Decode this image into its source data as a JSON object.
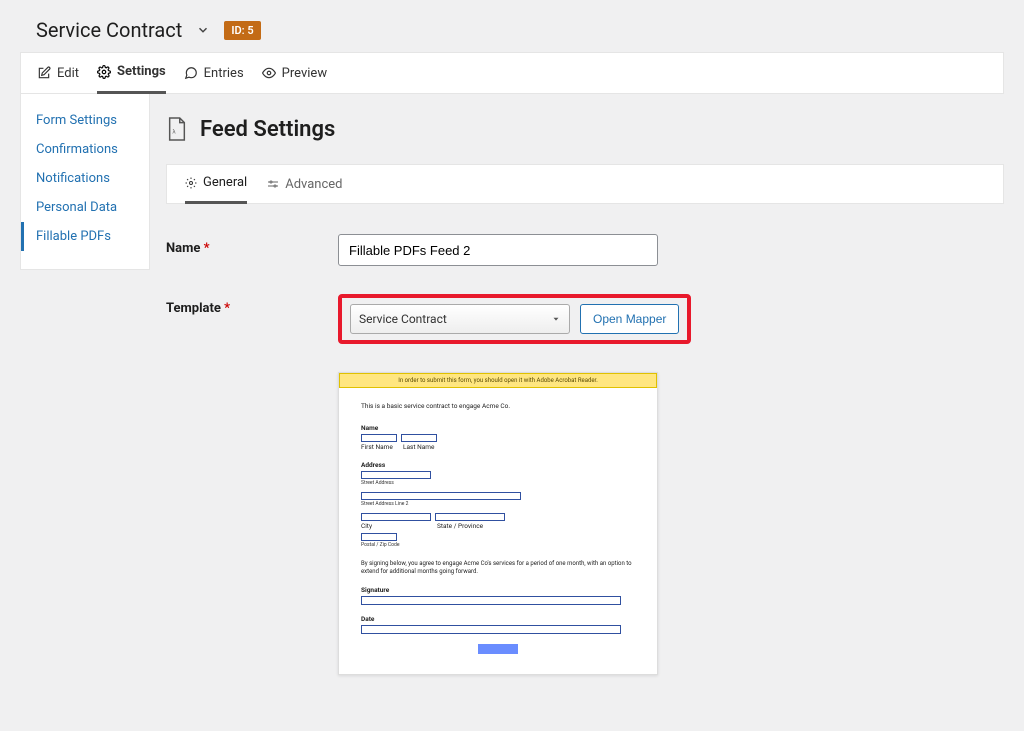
{
  "header": {
    "title": "Service Contract",
    "id_prefix": "ID:",
    "id_value": "5"
  },
  "tabs": {
    "edit": "Edit",
    "settings": "Settings",
    "entries": "Entries",
    "preview": "Preview"
  },
  "sidebar": {
    "items": [
      "Form Settings",
      "Confirmations",
      "Notifications",
      "Personal Data",
      "Fillable PDFs"
    ]
  },
  "main": {
    "title": "Feed Settings",
    "subtabs": {
      "general": "General",
      "advanced": "Advanced"
    },
    "name": {
      "label": "Name",
      "value": "Fillable PDFs Feed 2"
    },
    "template": {
      "label": "Template",
      "selected": "Service Contract",
      "open_mapper": "Open Mapper"
    }
  },
  "pdf": {
    "banner": "In order to submit this form, you should open it with Adobe Acrobat Reader.",
    "intro": "This is a basic service contract to engage Acme Co.",
    "name_label": "Name",
    "first_name": "First Name",
    "last_name": "Last Name",
    "address_label": "Address",
    "street": "Street Address",
    "street2": "Street Address Line 2",
    "city": "City",
    "state": "State / Province",
    "postal": "Postal / Zip Code",
    "consent": "By signing below, you agree to engage Acme Co's services for a period of one month, with an option to extend for additional months going forward.",
    "signature": "Signature",
    "date": "Date"
  }
}
